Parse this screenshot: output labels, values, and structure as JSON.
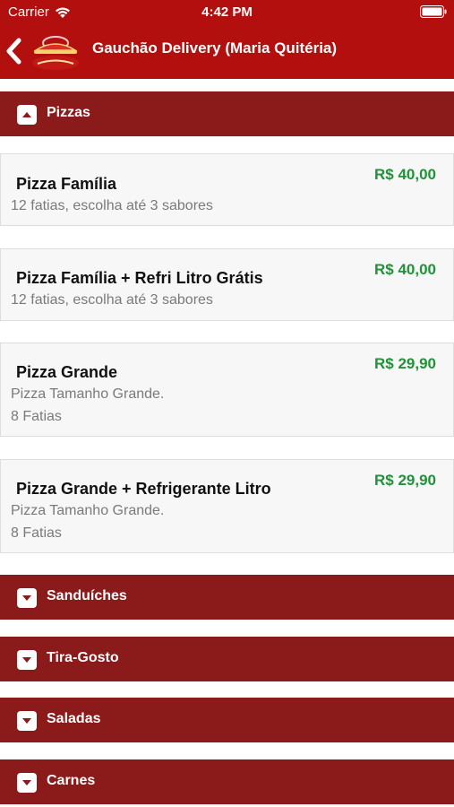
{
  "status_bar": {
    "carrier": "Carrier",
    "time": "4:42 PM",
    "icons": [
      "wifi-icon",
      "battery-icon"
    ]
  },
  "nav": {
    "title": "Gauchão Delivery (Maria Quitéria)",
    "back_icon": "chevron-left-icon",
    "logo_icon": "restaurant-logo"
  },
  "categories": [
    {
      "label": "Pizzas",
      "expanded": true,
      "items": [
        {
          "name": "Pizza Família",
          "description": [
            "12 fatias, escolha até 3 sabores"
          ],
          "price": "R$ 40,00"
        },
        {
          "name": "Pizza Família + Refri Litro Grátis",
          "description": [
            "12 fatias, escolha até 3 sabores"
          ],
          "price": "R$ 40,00"
        },
        {
          "name": "Pizza Grande",
          "description": [
            "Pizza Tamanho Grande.",
            "8 Fatias"
          ],
          "price": "R$ 29,90"
        },
        {
          "name": "Pizza Grande + Refrigerante Litro",
          "description": [
            "Pizza Tamanho Grande.",
            "8 Fatias"
          ],
          "price": "R$ 29,90"
        }
      ]
    },
    {
      "label": "Sanduíches",
      "expanded": false
    },
    {
      "label": "Tira-Gosto",
      "expanded": false
    },
    {
      "label": "Saladas",
      "expanded": false
    },
    {
      "label": "Carnes",
      "expanded": false
    }
  ],
  "colors": {
    "nav_background": "#b30f0f",
    "category_background": "#8b1a1a",
    "price": "#22913a",
    "card_background": "#f7f7f7"
  }
}
